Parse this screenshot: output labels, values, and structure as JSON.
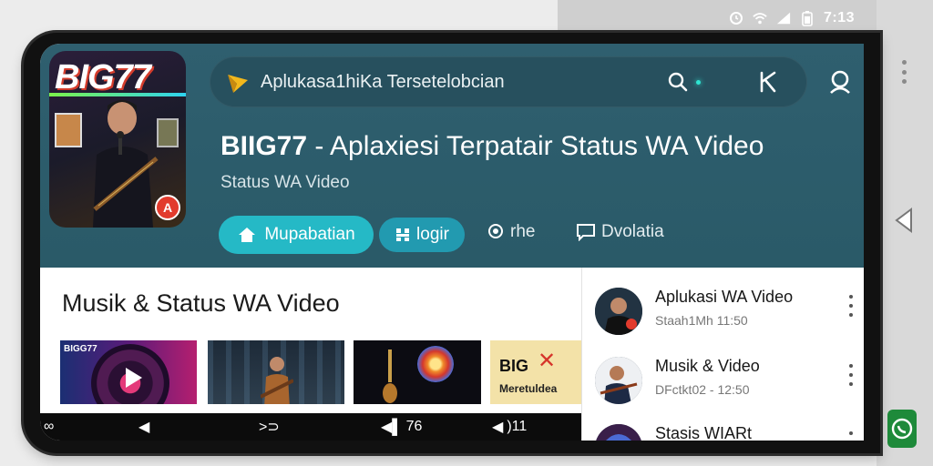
{
  "status_bar": {
    "time": "7:13",
    "icons": [
      "alarm-icon",
      "wifi-icon",
      "signal-icon",
      "battery-icon"
    ]
  },
  "app": {
    "icon_logo_text": "BIG77",
    "search": {
      "query": "Aplukasa1hiKa Tersetelobcian",
      "icons": [
        "app-logo-icon",
        "search-icon",
        "kiosk-icon",
        "account-icon"
      ]
    },
    "title_bold": "BIIG77",
    "title_rest": " - Aplaxiesi Terpatair Status WA Video",
    "subtitle": "Status WA Video",
    "actions": {
      "primary": "Mupabatian",
      "secondary": "logir",
      "share": "rhe",
      "review": "Dvolatia"
    }
  },
  "section": {
    "title": "Musik & Status WA Video",
    "thumbnails": [
      {
        "label": "BIGG77",
        "kind": "play-thumbnail"
      },
      {
        "label": "",
        "kind": "musician-thumbnail"
      },
      {
        "label": "",
        "kind": "guitar-burst-thumbnail"
      },
      {
        "brand": "BIG",
        "sub": "Meretuldea"
      }
    ]
  },
  "side_list": [
    {
      "title": "Aplukasi WA Video",
      "meta": "Staah1Mh  11:50"
    },
    {
      "title": "Musik & Video",
      "meta": "DFctkt02 - 12:50"
    },
    {
      "title": "Stasis WIARt",
      "meta": ""
    }
  ],
  "bottom_bar": {
    "items": [
      {
        "icon": "link-icon",
        "label": ""
      },
      {
        "icon": "volume-icon",
        "label": ""
      },
      {
        "icon": "forward-icon",
        "label": ""
      },
      {
        "icon": "speaker-icon",
        "label": "76"
      },
      {
        "icon": "speaker-out-icon",
        "label": ")11"
      }
    ]
  },
  "colors": {
    "header": "#2f5f6f",
    "accent": "#25b9c6",
    "secondary": "#229ab0"
  }
}
